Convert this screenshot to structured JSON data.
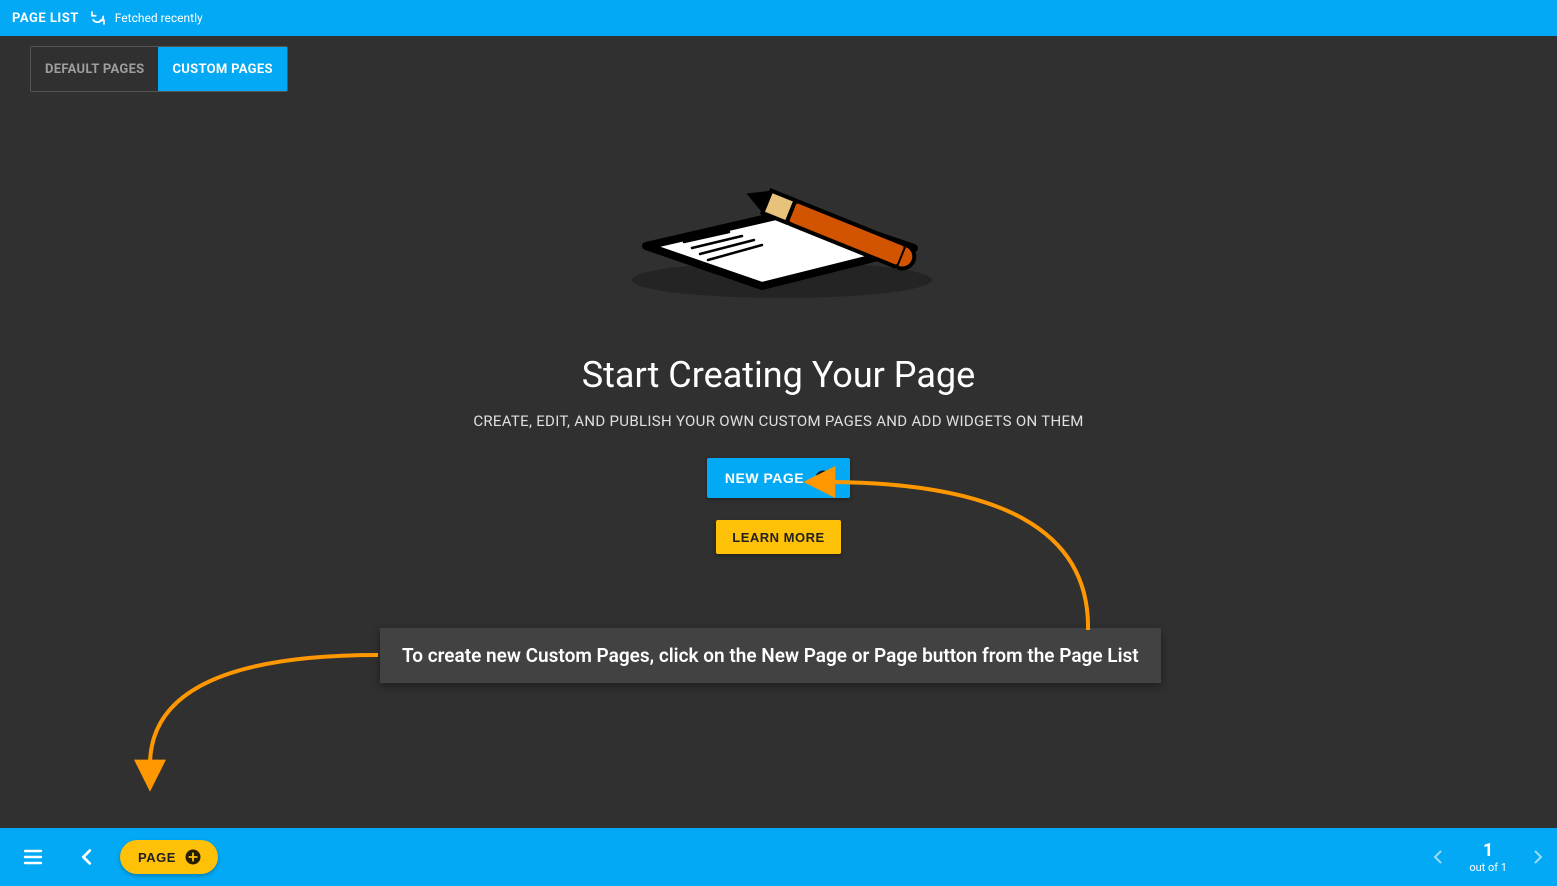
{
  "topbar": {
    "title": "PAGE LIST",
    "status": "Fetched recently"
  },
  "tabs": {
    "default": "DEFAULT PAGES",
    "custom": "CUSTOM PAGES"
  },
  "empty": {
    "headline": "Start Creating Your Page",
    "subline": "CREATE, EDIT, AND PUBLISH YOUR OWN CUSTOM PAGES AND ADD WIDGETS ON THEM",
    "newpage_label": "NEW PAGE",
    "learnmore_label": "LEARN MORE"
  },
  "annotation": {
    "text": "To create new Custom Pages, click on the New Page or Page button from the Page List"
  },
  "bottombar": {
    "page_button": "PAGE",
    "current_page": "1",
    "out_of": "out of 1"
  },
  "colors": {
    "accent": "#03a9f4",
    "amber": "#ffc107",
    "arrow": "#ff9800"
  }
}
